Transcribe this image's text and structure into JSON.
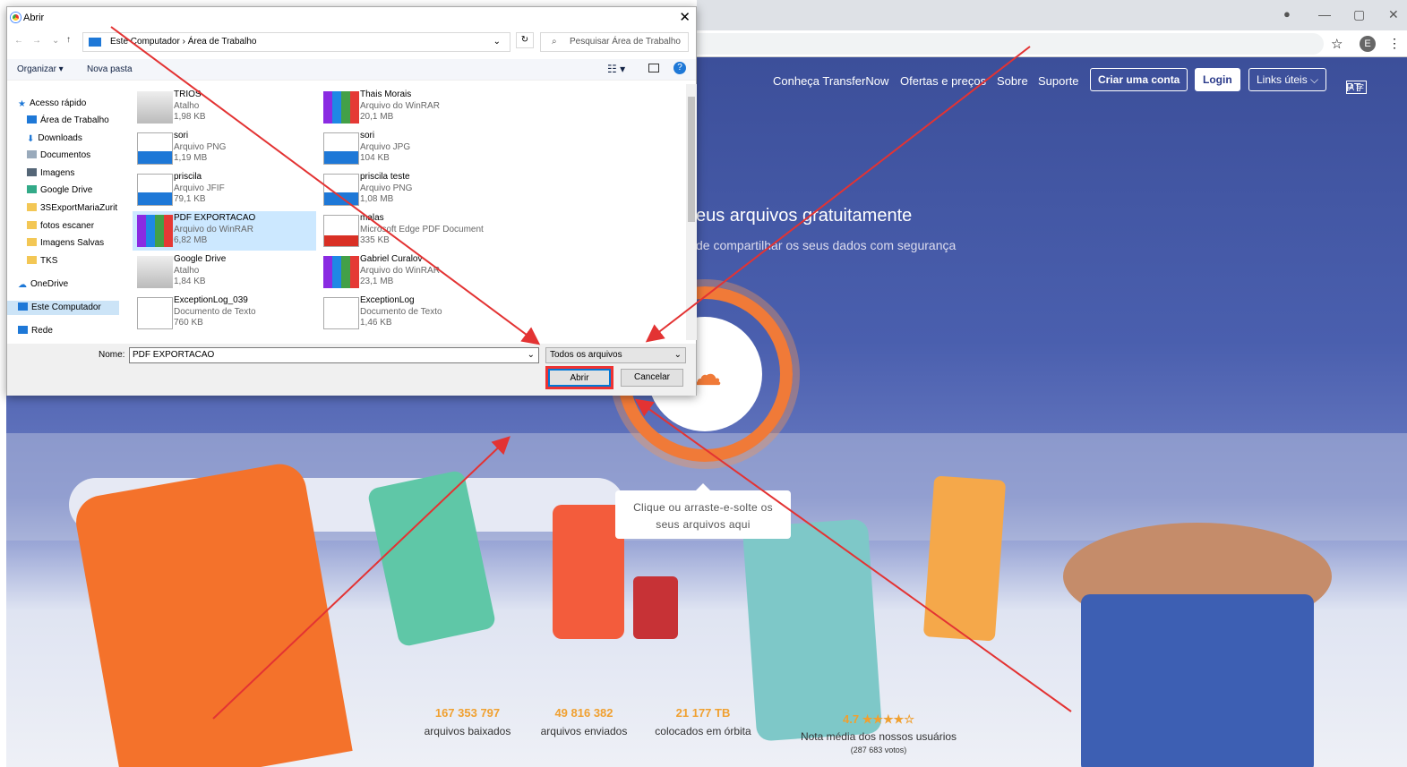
{
  "browser": {
    "win_min": "—",
    "win_max": "▢",
    "win_close": "✕",
    "star": "☆",
    "avatar": "E",
    "menu": "⋮"
  },
  "site": {
    "nav": [
      "Conheça TransferNow",
      "Ofertas e preços",
      "Sobre",
      "Suporte"
    ],
    "create_account": "Criar uma conta",
    "login": "Login",
    "links": "Links úteis ⌵",
    "lang": "PT",
    "hero_title": "eus arquivos gratuitamente",
    "hero_sub": "de compartilhar os seus dados com segurança",
    "tooltip_line1": "Clique ou arraste-e-solte os",
    "tooltip_line2": "seus arquivos aqui",
    "stats": [
      {
        "n": "167 353 797",
        "l": "arquivos baixados"
      },
      {
        "n": "49 816 382",
        "l": "arquivos enviados"
      },
      {
        "n": "21 177 TB",
        "l": "colocados em órbita"
      }
    ],
    "rating": "4.7 ★★★★☆",
    "rating_label": "Nota média dos nossos usuários",
    "votes": "(287 683 votos)"
  },
  "dialog": {
    "title": "Abrir",
    "close": "✕",
    "path": [
      "Este Computador",
      "›",
      "Área de Trabalho"
    ],
    "search_placeholder": "Pesquisar Área de Trabalho",
    "organize": "Organizar ▾",
    "new_folder": "Nova pasta",
    "sidebar": [
      "Acesso rápido",
      "Área de Trabalho",
      "Downloads",
      "Documentos",
      "Imagens",
      "Google Drive",
      "3SExportMariaZurit",
      "fotos escaner",
      "Imagens Salvas",
      "TKS",
      "OneDrive",
      "Este Computador",
      "Rede"
    ],
    "files": [
      {
        "name": "TRIOS",
        "type": "Atalho",
        "size": "1,98 KB"
      },
      {
        "name": "Thais Morais",
        "type": "Arquivo do WinRAR",
        "size": "20,1 MB"
      },
      {
        "name": "sori",
        "type": "Arquivo PNG",
        "size": "1,19 MB"
      },
      {
        "name": "sori",
        "type": "Arquivo JPG",
        "size": "104 KB"
      },
      {
        "name": "priscila",
        "type": "Arquivo JFIF",
        "size": "79,1 KB"
      },
      {
        "name": "priscila teste",
        "type": "Arquivo PNG",
        "size": "1,08 MB"
      },
      {
        "name": "PDF EXPORTACAO",
        "type": "Arquivo do WinRAR",
        "size": "6,82 MB"
      },
      {
        "name": "malas",
        "type": "Microsoft Edge PDF Document",
        "size": "335 KB"
      },
      {
        "name": "Google Drive",
        "type": "Atalho",
        "size": "1,84 KB"
      },
      {
        "name": "Gabriel Curalov",
        "type": "Arquivo do WinRAR",
        "size": "23,1 MB"
      },
      {
        "name": "ExceptionLog_039",
        "type": "Documento de Texto",
        "size": "760 KB"
      },
      {
        "name": "ExceptionLog",
        "type": "Documento de Texto",
        "size": "1,46 KB"
      }
    ],
    "name_label": "Nome:",
    "name_value": "PDF EXPORTACAO",
    "type_value": "Todos os arquivos",
    "open": "Abrir",
    "cancel": "Cancelar"
  },
  "colors": {
    "accent": "#f07a38",
    "annotation": "#e33333"
  }
}
